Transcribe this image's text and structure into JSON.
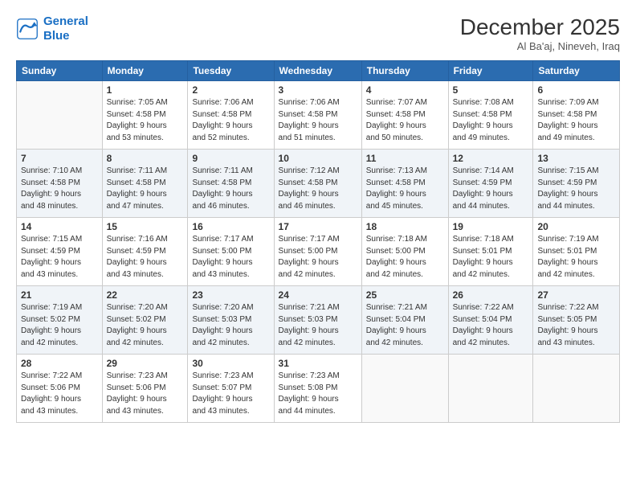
{
  "logo": {
    "line1": "General",
    "line2": "Blue"
  },
  "title": "December 2025",
  "location": "Al Ba'aj, Nineveh, Iraq",
  "days_header": [
    "Sunday",
    "Monday",
    "Tuesday",
    "Wednesday",
    "Thursday",
    "Friday",
    "Saturday"
  ],
  "weeks": [
    [
      {
        "day": "",
        "info": ""
      },
      {
        "day": "1",
        "info": "Sunrise: 7:05 AM\nSunset: 4:58 PM\nDaylight: 9 hours\nand 53 minutes."
      },
      {
        "day": "2",
        "info": "Sunrise: 7:06 AM\nSunset: 4:58 PM\nDaylight: 9 hours\nand 52 minutes."
      },
      {
        "day": "3",
        "info": "Sunrise: 7:06 AM\nSunset: 4:58 PM\nDaylight: 9 hours\nand 51 minutes."
      },
      {
        "day": "4",
        "info": "Sunrise: 7:07 AM\nSunset: 4:58 PM\nDaylight: 9 hours\nand 50 minutes."
      },
      {
        "day": "5",
        "info": "Sunrise: 7:08 AM\nSunset: 4:58 PM\nDaylight: 9 hours\nand 49 minutes."
      },
      {
        "day": "6",
        "info": "Sunrise: 7:09 AM\nSunset: 4:58 PM\nDaylight: 9 hours\nand 49 minutes."
      }
    ],
    [
      {
        "day": "7",
        "info": "Sunrise: 7:10 AM\nSunset: 4:58 PM\nDaylight: 9 hours\nand 48 minutes."
      },
      {
        "day": "8",
        "info": "Sunrise: 7:11 AM\nSunset: 4:58 PM\nDaylight: 9 hours\nand 47 minutes."
      },
      {
        "day": "9",
        "info": "Sunrise: 7:11 AM\nSunset: 4:58 PM\nDaylight: 9 hours\nand 46 minutes."
      },
      {
        "day": "10",
        "info": "Sunrise: 7:12 AM\nSunset: 4:58 PM\nDaylight: 9 hours\nand 46 minutes."
      },
      {
        "day": "11",
        "info": "Sunrise: 7:13 AM\nSunset: 4:58 PM\nDaylight: 9 hours\nand 45 minutes."
      },
      {
        "day": "12",
        "info": "Sunrise: 7:14 AM\nSunset: 4:59 PM\nDaylight: 9 hours\nand 44 minutes."
      },
      {
        "day": "13",
        "info": "Sunrise: 7:15 AM\nSunset: 4:59 PM\nDaylight: 9 hours\nand 44 minutes."
      }
    ],
    [
      {
        "day": "14",
        "info": "Sunrise: 7:15 AM\nSunset: 4:59 PM\nDaylight: 9 hours\nand 43 minutes."
      },
      {
        "day": "15",
        "info": "Sunrise: 7:16 AM\nSunset: 4:59 PM\nDaylight: 9 hours\nand 43 minutes."
      },
      {
        "day": "16",
        "info": "Sunrise: 7:17 AM\nSunset: 5:00 PM\nDaylight: 9 hours\nand 43 minutes."
      },
      {
        "day": "17",
        "info": "Sunrise: 7:17 AM\nSunset: 5:00 PM\nDaylight: 9 hours\nand 42 minutes."
      },
      {
        "day": "18",
        "info": "Sunrise: 7:18 AM\nSunset: 5:00 PM\nDaylight: 9 hours\nand 42 minutes."
      },
      {
        "day": "19",
        "info": "Sunrise: 7:18 AM\nSunset: 5:01 PM\nDaylight: 9 hours\nand 42 minutes."
      },
      {
        "day": "20",
        "info": "Sunrise: 7:19 AM\nSunset: 5:01 PM\nDaylight: 9 hours\nand 42 minutes."
      }
    ],
    [
      {
        "day": "21",
        "info": "Sunrise: 7:19 AM\nSunset: 5:02 PM\nDaylight: 9 hours\nand 42 minutes."
      },
      {
        "day": "22",
        "info": "Sunrise: 7:20 AM\nSunset: 5:02 PM\nDaylight: 9 hours\nand 42 minutes."
      },
      {
        "day": "23",
        "info": "Sunrise: 7:20 AM\nSunset: 5:03 PM\nDaylight: 9 hours\nand 42 minutes."
      },
      {
        "day": "24",
        "info": "Sunrise: 7:21 AM\nSunset: 5:03 PM\nDaylight: 9 hours\nand 42 minutes."
      },
      {
        "day": "25",
        "info": "Sunrise: 7:21 AM\nSunset: 5:04 PM\nDaylight: 9 hours\nand 42 minutes."
      },
      {
        "day": "26",
        "info": "Sunrise: 7:22 AM\nSunset: 5:04 PM\nDaylight: 9 hours\nand 42 minutes."
      },
      {
        "day": "27",
        "info": "Sunrise: 7:22 AM\nSunset: 5:05 PM\nDaylight: 9 hours\nand 43 minutes."
      }
    ],
    [
      {
        "day": "28",
        "info": "Sunrise: 7:22 AM\nSunset: 5:06 PM\nDaylight: 9 hours\nand 43 minutes."
      },
      {
        "day": "29",
        "info": "Sunrise: 7:23 AM\nSunset: 5:06 PM\nDaylight: 9 hours\nand 43 minutes."
      },
      {
        "day": "30",
        "info": "Sunrise: 7:23 AM\nSunset: 5:07 PM\nDaylight: 9 hours\nand 43 minutes."
      },
      {
        "day": "31",
        "info": "Sunrise: 7:23 AM\nSunset: 5:08 PM\nDaylight: 9 hours\nand 44 minutes."
      },
      {
        "day": "",
        "info": ""
      },
      {
        "day": "",
        "info": ""
      },
      {
        "day": "",
        "info": ""
      }
    ]
  ]
}
